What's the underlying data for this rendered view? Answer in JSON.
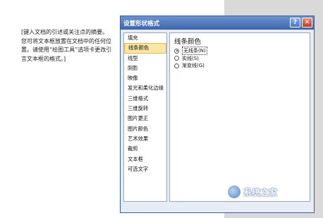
{
  "document": {
    "text": "[键入文档的引述或关注点的摘要。您可将文本框放置在文档中的任何位置。请使用“绘图工具”选项卡更改引言文本框的格式。]"
  },
  "dialog": {
    "title": "设置形状格式",
    "help_label": "?",
    "close_label": "✕",
    "sidebar": [
      {
        "label": "填充",
        "selected": false
      },
      {
        "label": "线条颜色",
        "selected": true
      },
      {
        "label": "线型",
        "selected": false
      },
      {
        "label": "阴影",
        "selected": false
      },
      {
        "label": "映像",
        "selected": false
      },
      {
        "label": "发光和柔化边缘",
        "selected": false
      },
      {
        "label": "三维格式",
        "selected": false
      },
      {
        "label": "三维旋转",
        "selected": false
      },
      {
        "label": "图片更正",
        "selected": false
      },
      {
        "label": "图片颜色",
        "selected": false
      },
      {
        "label": "艺术效果",
        "selected": false
      },
      {
        "label": "裁剪",
        "selected": false
      },
      {
        "label": "文本框",
        "selected": false
      },
      {
        "label": "可选文字",
        "selected": false
      }
    ],
    "section_title": "线条颜色",
    "options": [
      {
        "label": "无线条(N)",
        "checked": true
      },
      {
        "label": "实线(S)",
        "checked": false
      },
      {
        "label": "渐变线(G)",
        "checked": false
      }
    ]
  },
  "watermark": {
    "text": "系统之家"
  }
}
